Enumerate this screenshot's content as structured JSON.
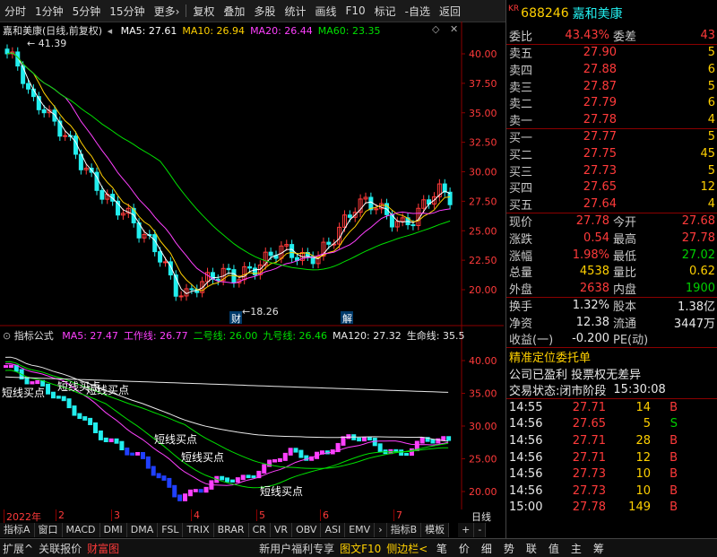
{
  "toolbar": {
    "items": [
      "分时",
      "1分钟",
      "5分钟",
      "15分钟",
      "更多›",
      "复权",
      "叠加",
      "多股",
      "统计",
      "画线",
      "F10",
      "标记",
      "-自选",
      "返回"
    ]
  },
  "main_chart": {
    "title": "嘉和美康(日线,前复权)",
    "ma": [
      {
        "label": "MA5: 27.61",
        "color": "#ffffff"
      },
      {
        "label": "MA10: 26.94",
        "color": "#ffd000"
      },
      {
        "label": "MA20: 26.44",
        "color": "#ff40ff"
      },
      {
        "label": "MA60: 23.35",
        "color": "#00e000"
      }
    ],
    "high_label": "41.39",
    "low_label": "18.26",
    "markers": [
      "财",
      "解"
    ],
    "y_ticks": [
      "40.00",
      "37.50",
      "35.00",
      "32.50",
      "30.00",
      "27.50",
      "25.00",
      "22.50",
      "20.00"
    ]
  },
  "sub_chart": {
    "title": "指标公式",
    "lines": [
      {
        "label": "MA5: 27.47",
        "color": "#ff40ff"
      },
      {
        "label": "工作线: 26.77",
        "color": "#ff40ff"
      },
      {
        "label": "二号线: 26.00",
        "color": "#00e000"
      },
      {
        "label": "九号线: 26.46",
        "color": "#00e000"
      },
      {
        "label": "MA120: 27.32",
        "color": "#e8e8e8"
      },
      {
        "label": "生命线: 35.5",
        "color": "#e8e8e8"
      }
    ],
    "annotations": [
      "短线买点",
      "短线买点",
      "短线买点",
      "短线买点",
      "短线买点",
      "短线买点"
    ],
    "y_ticks": [
      "40.00",
      "35.00",
      "30.00",
      "25.00",
      "20.00"
    ]
  },
  "x_axis": {
    "labels": [
      "2022年",
      "2",
      "3",
      "4",
      "5",
      "6",
      "7"
    ],
    "period_label": "日线"
  },
  "zoom": {
    "plus": "+",
    "minus": "-"
  },
  "tabs": [
    "指标A",
    "窗口",
    "MACD",
    "DMI",
    "DMA",
    "FSL",
    "TRIX",
    "BRAR",
    "CR",
    "VR",
    "OBV",
    "ASI",
    "EMV",
    "›",
    "指标B",
    "模板"
  ],
  "quote": {
    "badge": "KR",
    "code": "688246",
    "name": "嘉和美康",
    "weibi_label": "委比",
    "weibi": "43.43%",
    "weicha_label": "委差",
    "weicha": "43",
    "asks": [
      {
        "label": "卖五",
        "price": "27.90",
        "vol": "5"
      },
      {
        "label": "卖四",
        "price": "27.88",
        "vol": "6"
      },
      {
        "label": "卖三",
        "price": "27.87",
        "vol": "5"
      },
      {
        "label": "卖二",
        "price": "27.79",
        "vol": "6"
      },
      {
        "label": "卖一",
        "price": "27.78",
        "vol": "4"
      }
    ],
    "bids": [
      {
        "label": "买一",
        "price": "27.77",
        "vol": "5"
      },
      {
        "label": "买二",
        "price": "27.75",
        "vol": "45"
      },
      {
        "label": "买三",
        "price": "27.73",
        "vol": "5"
      },
      {
        "label": "买四",
        "price": "27.65",
        "vol": "12"
      },
      {
        "label": "买五",
        "price": "27.64",
        "vol": "4"
      }
    ],
    "stats": [
      {
        "l1": "现价",
        "v1": "27.78",
        "c1": "red",
        "l2": "今开",
        "v2": "27.68",
        "c2": "red"
      },
      {
        "l1": "涨跌",
        "v1": "0.54",
        "c1": "red",
        "l2": "最高",
        "v2": "27.78",
        "c2": "red"
      },
      {
        "l1": "涨幅",
        "v1": "1.98%",
        "c1": "red",
        "l2": "最低",
        "v2": "27.02",
        "c2": "green"
      },
      {
        "l1": "总量",
        "v1": "4538",
        "c1": "yellow",
        "l2": "量比",
        "v2": "0.62",
        "c2": "yellow"
      },
      {
        "l1": "外盘",
        "v1": "2638",
        "c1": "red",
        "l2": "内盘",
        "v2": "1900",
        "c2": "green"
      }
    ],
    "stats2": [
      {
        "l1": "换手",
        "v1": "1.32%",
        "l2": "股本",
        "v2": "1.38亿"
      },
      {
        "l1": "净资",
        "v1": "12.38",
        "l2": "流通",
        "v2": "3447万"
      },
      {
        "l1": "收益(一)",
        "v1": "-0.200",
        "l2": "PE(动)",
        "v2": ""
      }
    ],
    "note1": "精准定位委托单",
    "note2": "公司已盈利 投票权无差异",
    "trade_status_label": "交易状态:",
    "trade_status": "闭市阶段",
    "trade_time": "15:30:08",
    "ticks": [
      {
        "t": "14:55",
        "p": "27.71",
        "v": "14",
        "s": "B"
      },
      {
        "t": "14:56",
        "p": "27.65",
        "v": "5",
        "s": "S"
      },
      {
        "t": "14:56",
        "p": "27.71",
        "v": "28",
        "s": "B"
      },
      {
        "t": "14:56",
        "p": "27.71",
        "v": "12",
        "s": "B"
      },
      {
        "t": "14:56",
        "p": "27.73",
        "v": "10",
        "s": "B"
      },
      {
        "t": "14:56",
        "p": "27.73",
        "v": "10",
        "s": "B"
      },
      {
        "t": "15:00",
        "p": "27.78",
        "v": "149",
        "s": "B"
      }
    ]
  },
  "bottombar": {
    "left": [
      "扩展^",
      "关联报价",
      "财富图"
    ],
    "promo": "新用户福利专享",
    "f10": "图文F10",
    "sidebar": "侧边栏<",
    "icons": [
      "笔",
      "价",
      "细",
      "势",
      "联",
      "值",
      "主",
      "筹"
    ]
  }
}
